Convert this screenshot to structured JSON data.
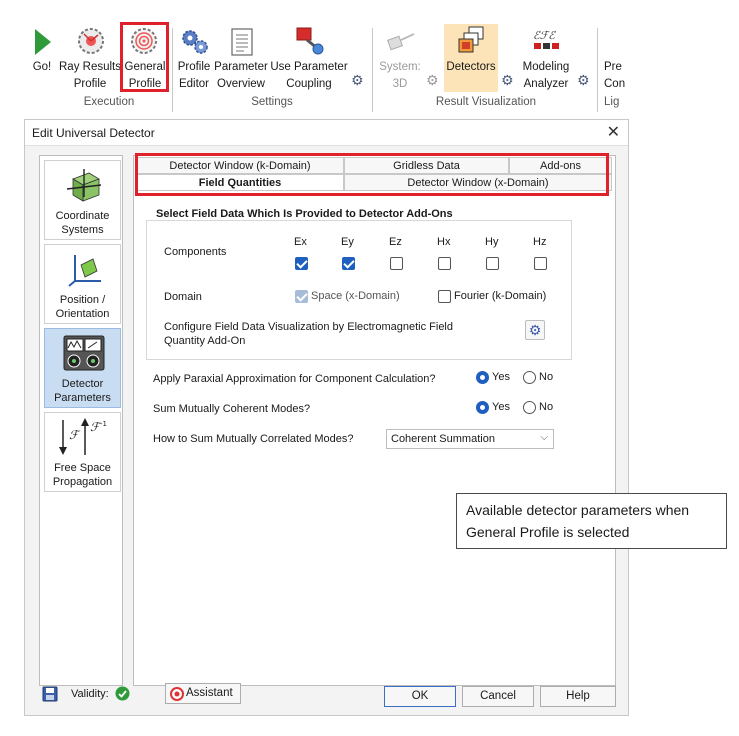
{
  "ribbon": {
    "go_label": "Go!",
    "ray_results_label": [
      "Ray Results",
      "Profile"
    ],
    "general_profile_label": [
      "General",
      "Profile"
    ],
    "profile_editor_label": [
      "Profile",
      "Editor"
    ],
    "parameter_overview_label": [
      "Parameter",
      "Overview"
    ],
    "use_parameter_coupling_label": [
      "Use Parameter",
      "Coupling"
    ],
    "system_3d_label": [
      "System:",
      "3D"
    ],
    "detectors_label": "Detectors",
    "modeling_analyzer_label": [
      "Modeling",
      "Analyzer"
    ],
    "pre_con_label": [
      "Pre",
      "Con"
    ],
    "groups": {
      "execution": "Execution",
      "settings": "Settings",
      "result_visualization": "Result Visualization",
      "lig": "Lig"
    }
  },
  "dialog": {
    "title": "Edit Universal Detector",
    "close_glyph": "✕",
    "left_panel": [
      {
        "label": [
          "Coordinate",
          "Systems"
        ]
      },
      {
        "label": [
          "Position /",
          "Orientation"
        ]
      },
      {
        "label": [
          "Detector",
          "Parameters"
        ],
        "selected": true
      },
      {
        "label": [
          "Free Space",
          "Propagation"
        ]
      }
    ],
    "tabs": {
      "row1": [
        "Detector Window (k-Domain)",
        "Gridless Data",
        "Add-ons"
      ],
      "row2": [
        "Field Quantities",
        "Detector Window (x-Domain)"
      ],
      "active": "Field Quantities"
    },
    "field_group": {
      "title": "Select Field Data Which Is Provided to Detector Add-Ons",
      "components_label": "Components",
      "components": [
        {
          "name": "Ex",
          "checked": true
        },
        {
          "name": "Ey",
          "checked": true
        },
        {
          "name": "Ez",
          "checked": false
        },
        {
          "name": "Hx",
          "checked": false
        },
        {
          "name": "Hy",
          "checked": false
        },
        {
          "name": "Hz",
          "checked": false
        }
      ],
      "domain_label": "Domain",
      "space_domain": "Space (x-Domain)",
      "fourier_domain": "Fourier (k-Domain)",
      "configure_label": [
        "Configure Field Data Visualization by Electromagnetic Field",
        "Quantity Add-On"
      ]
    },
    "paraxial": {
      "label": "Apply Paraxial Approximation for Component Calculation?",
      "yes": "Yes",
      "no": "No",
      "value": "Yes"
    },
    "sum_coherent": {
      "label": "Sum Mutually Coherent Modes?",
      "yes": "Yes",
      "no": "No",
      "value": "Yes"
    },
    "correlated": {
      "label": "How to Sum Mutually Correlated Modes?",
      "selected": "Coherent Summation"
    },
    "footer": {
      "validity_label": "Validity:",
      "assistant": "Assistant",
      "ok": "OK",
      "cancel": "Cancel",
      "help": "Help"
    }
  },
  "callout": {
    "line1": "Available detector parameters when",
    "line2": "General Profile is selected"
  },
  "colors": {
    "highlight_red": "#e0202a",
    "accent_blue": "#1f5fbf",
    "detectors_highlight": "#fce4b8",
    "selected_item_bg": "#c9ddf2"
  }
}
